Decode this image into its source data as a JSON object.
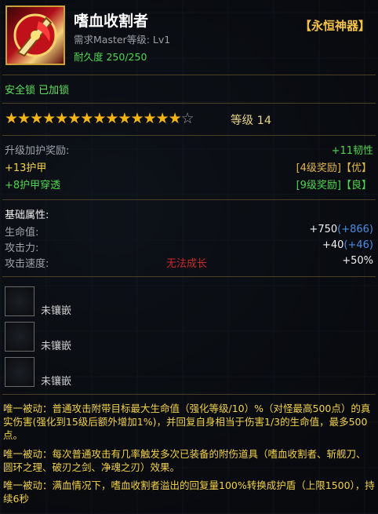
{
  "item": {
    "name": "嗜血收割者",
    "requirement": "需求Master等级: Lv1",
    "durability": "耐久度 250/250",
    "tier": "【永恒神器】",
    "safety_lock": "安全锁 已加锁",
    "stars_filled": 14,
    "stars_total": 15,
    "level_label": "等级 14"
  },
  "upgrade": {
    "header": "升级加护奖励:",
    "header_value": "+11韧性",
    "rows": [
      {
        "left": "+13护甲",
        "right": "[4级奖励]【优】"
      },
      {
        "left": "+8护甲穿透",
        "right": "[9级奖励]【良】"
      }
    ]
  },
  "base_stats": {
    "header": "基础属性:",
    "rows": [
      {
        "label": "生命值:",
        "value": "+750",
        "bonus": "(+866)"
      },
      {
        "label": "攻击力:",
        "value": "+40",
        "bonus": "(+46)"
      },
      {
        "label": "攻击速度:",
        "value": "+50%",
        "bonus": ""
      }
    ],
    "no_growth": "无法成长"
  },
  "sockets": [
    {
      "label": "未镶嵌"
    },
    {
      "label": "未镶嵌"
    },
    {
      "label": "未镶嵌"
    }
  ],
  "descriptions": [
    "唯一被动：普通攻击附带目标最大生命值（强化等级/10）%（对怪最高500点）的真实伤害(强化到15级后额外增加1%)，并回复自身相当于伤害1/3的生命值，最多500点。",
    "唯一被动：每次普通攻击有几率触发多次已装备的附伤道具（嗜血收割者、斩舰刀、圆环之理、破刃之剑、净魂之刃）效果。",
    "唯一被动：满血情况下，嗜血收割者溢出的回复量100%转换成护盾（上限1500），持续6秒"
  ],
  "colors": {
    "accent": "#f3c24a",
    "green": "#4fd64f",
    "blue": "#4a8de3",
    "red": "#c92a2a"
  }
}
